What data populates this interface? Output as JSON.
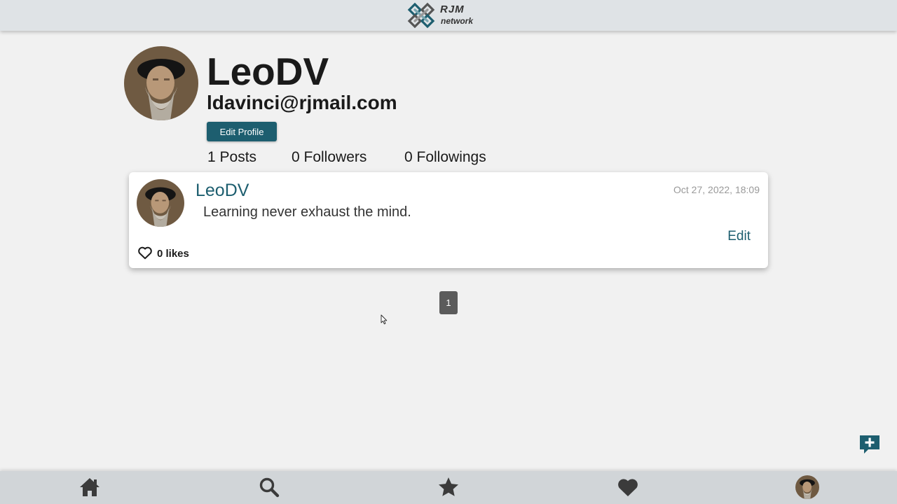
{
  "header": {
    "logo_line1": "RJM",
    "logo_line2": "network",
    "brand_color": "#1d5e6f"
  },
  "profile": {
    "username": "LeoDV",
    "email": "ldavinci@rjmail.com",
    "edit_profile_label": "Edit Profile",
    "stats": {
      "posts": "1 Posts",
      "followers": "0 Followers",
      "followings": "0 Followings"
    }
  },
  "posts": [
    {
      "author": "LeoDV",
      "timestamp": "Oct 27, 2022, 18:09",
      "content": "Learning never exhaust the mind.",
      "edit_label": "Edit",
      "likes_label": "0 likes"
    }
  ],
  "pagination": {
    "current_page": "1"
  },
  "icons": {
    "fab": "add-comment-icon",
    "nav": [
      "home-icon",
      "search-icon",
      "star-icon",
      "heart-icon",
      "avatar"
    ]
  }
}
